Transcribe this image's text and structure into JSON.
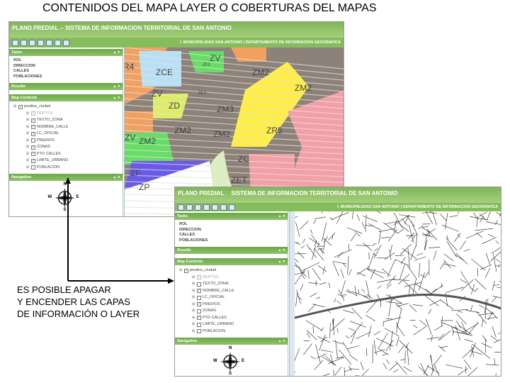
{
  "slide_title": "CONTENIDOS DEL MAPA  LAYER O COBERTURAS DEL MAPAS",
  "caption": [
    "ES POSIBLE APAGAR",
    "Y ENCENDER LAS CAPAS",
    "DE INFORMACIÓN O LAYER"
  ],
  "colors": {
    "header_green": "#7fb557",
    "panel_green": "#6aa845"
  },
  "screens": [
    {
      "header": [
        "PLANO PREDIAL -- SISTEMA DE INFORMACION TERRITORIAL DE SAN ANTONIO"
      ],
      "subheader": "I. MUNICIPALIDAD SAN ANTONIO | DEPARTAMENTO DE INFORMACION GEOGRAFICA",
      "toolbar": [
        "zoom-in",
        "zoom-out",
        "pan",
        "full-extent",
        "identify",
        "measure",
        "print"
      ],
      "panels": {
        "tasks": "Tasks",
        "results": "Results",
        "map_contents": "Map Contents",
        "navigation": "Navigation"
      },
      "tasks": [
        "ROL",
        "DIRECCION",
        "CALLES",
        "POBLACIONES"
      ],
      "root_layer": {
        "label": "predios_ciudad",
        "checked": true
      },
      "layers": [
        {
          "label": "DEPTOS",
          "checked": true,
          "disabled": true
        },
        {
          "label": "TEXTO_ZONA",
          "checked": true
        },
        {
          "label": "NOMBRE_CALLE",
          "checked": true
        },
        {
          "label": "LC_OFICIAL",
          "checked": true
        },
        {
          "label": "PREDIOS",
          "checked": false
        },
        {
          "label": "ZONAS",
          "checked": true
        },
        {
          "label": "PTO CALLES",
          "checked": true
        },
        {
          "label": "LIMITE_URBANO",
          "checked": true
        },
        {
          "label": "POBLACION",
          "checked": false
        }
      ],
      "compass": [
        "N",
        "S",
        "E",
        "W"
      ],
      "map_labels": [
        "R4",
        "ZCE",
        "ZV",
        "ZF3",
        "ZM2",
        "ZV",
        "ZE3",
        "ZD",
        "ZM2",
        "ZM3",
        "ZM2",
        "ZM2",
        "ZV",
        "ZM2",
        "ZR5",
        "ZC",
        "ZF",
        "ZP",
        "ZET",
        "ZR5"
      ]
    },
    {
      "header": [
        "PLANO PREDIAL",
        "SISTEMA DE INFORMACION TERRITORIAL DE SAN ANTONIO"
      ],
      "subheader": "I. MUNICIPALIDAD SAN ANTONIO | DEPARTAMENTO DE INFORMACION GEOGRAFICA",
      "toolbar": [
        "zoom-in",
        "zoom-out",
        "pan",
        "full-extent",
        "identify",
        "measure",
        "print"
      ],
      "panels": {
        "tasks": "Tasks",
        "results": "Results",
        "map_contents": "Map Contents",
        "navigation": "Navigation"
      },
      "tasks": [
        "ROL",
        "DIRECCION",
        "CALLES",
        "POBLACIONES"
      ],
      "root_layer": {
        "label": "predios_ciudad",
        "checked": true
      },
      "layers": [
        {
          "label": "DEPTOS",
          "checked": true,
          "disabled": true
        },
        {
          "label": "TEXTO_ZONA",
          "checked": false
        },
        {
          "label": "NOMBRE_CALLE",
          "checked": true
        },
        {
          "label": "LC_OFICIAL",
          "checked": false
        },
        {
          "label": "PREDIOS",
          "checked": true
        },
        {
          "label": "ZONAS",
          "checked": false
        },
        {
          "label": "PTO CALLES",
          "checked": true
        },
        {
          "label": "LIMITE_URBANO",
          "checked": false
        },
        {
          "label": "POBLACION",
          "checked": false
        }
      ],
      "compass": [
        "N",
        "S",
        "E",
        "W"
      ],
      "map_labels": []
    }
  ]
}
